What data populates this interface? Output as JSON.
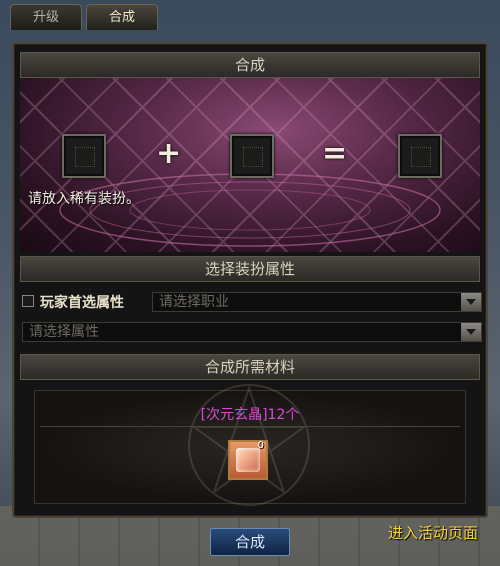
{
  "tabs": [
    {
      "label": "升级",
      "active": false
    },
    {
      "label": "合成",
      "active": true
    }
  ],
  "panel": {
    "title": "合成"
  },
  "stage": {
    "hint": "请放入稀有装扮。",
    "plus": "+",
    "equals": "="
  },
  "attributes": {
    "title": "选择装扮属性",
    "preferred_label": "玩家首选属性",
    "job_placeholder": "请选择职业",
    "attr_placeholder": "请选择属性"
  },
  "materials": {
    "title": "合成所需材料",
    "item": "[次元玄晶]12个",
    "count": "0"
  },
  "buttons": {
    "synthesize": "合成"
  },
  "link": {
    "event_page": "进入活动页面"
  },
  "colors": {
    "material_text": "#d84ad4",
    "link": "#f4d030",
    "button": "#1b3a66"
  }
}
